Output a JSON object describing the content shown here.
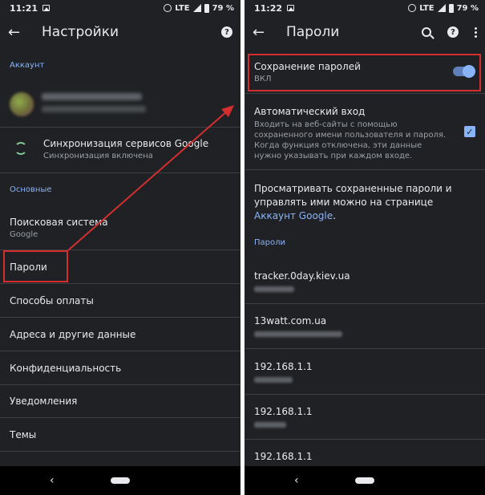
{
  "status_left": {
    "time": "11:21",
    "network": "LTE",
    "battery": "79 %"
  },
  "status_right": {
    "time": "11:22",
    "network": "LTE",
    "battery": "79 %"
  },
  "settings": {
    "title": "Настройки",
    "account_header": "Аккаунт",
    "sync_title": "Синхронизация сервисов Google",
    "sync_sub": "Синхронизация включена",
    "basic_header": "Основные",
    "search_engine_title": "Поисковая система",
    "search_engine_value": "Google",
    "passwords": "Пароли",
    "payment": "Способы оплаты",
    "addresses": "Адреса и другие данные",
    "privacy": "Конфиденциальность",
    "notifications": "Уведомления",
    "themes": "Темы"
  },
  "passwords_screen": {
    "title": "Пароли",
    "save_title": "Сохранение паролей",
    "save_state": "ВКЛ",
    "autologin_title": "Автоматический вход",
    "autologin_desc": "Входить на веб-сайты с помощью сохраненного имени пользователя и пароля. Когда функция отключена, эти данные нужно указывать при каждом входе.",
    "manage_text": "Просматривать сохраненные пароли и управлять ими можно на странице ",
    "manage_link": "Аккаунт Google",
    "manage_end": ".",
    "passwords_header": "Пароли",
    "sites": [
      "tracker.0day.kiev.ua",
      "13watt.com.ua",
      "192.168.1.1",
      "192.168.1.1",
      "192.168.1.1"
    ]
  },
  "colors": {
    "background": "#202124",
    "accent": "#8ab4f8",
    "highlight": "#d32f2f"
  }
}
